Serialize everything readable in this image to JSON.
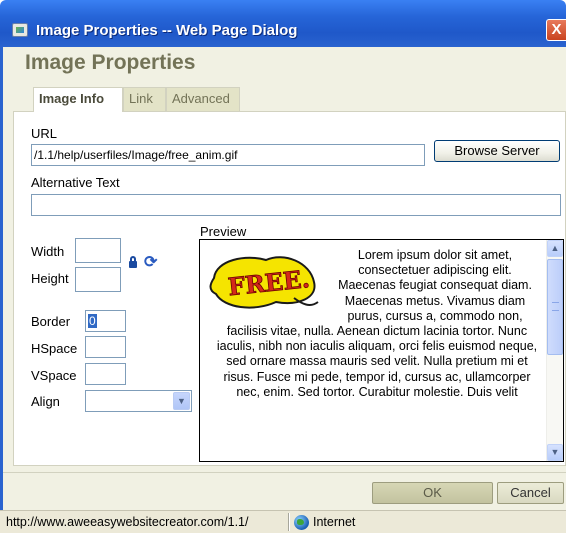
{
  "window": {
    "title": "Image Properties -- Web Page Dialog",
    "close_glyph": "X"
  },
  "dialog": {
    "heading": "Image Properties",
    "tabs": [
      {
        "label": "Image Info",
        "active": true
      },
      {
        "label": "Link",
        "active": false
      },
      {
        "label": "Advanced",
        "active": false
      }
    ]
  },
  "image_info": {
    "url_label": "URL",
    "url_value": "/1.1/help/userfiles/Image/free_anim.gif",
    "browse_label": "Browse Server",
    "alt_label": "Alternative Text",
    "alt_value": "",
    "width_label": "Width",
    "width_value": "",
    "height_label": "Height",
    "height_value": "",
    "border_label": "Border",
    "border_value": "0",
    "hspace_label": "HSpace",
    "hspace_value": "",
    "vspace_label": "VSpace",
    "vspace_value": "",
    "align_label": "Align",
    "align_value": "",
    "preview_label": "Preview",
    "preview_text": "Lorem ipsum dolor sit amet, consectetuer adipiscing elit. Maecenas feugiat consequat diam. Maecenas metus. Vivamus diam purus, cursus a, commodo non, facilisis vitae, nulla. Aenean dictum lacinia tortor. Nunc iaculis, nibh non iaculis aliquam, orci felis euismod neque, sed ornare massa mauris sed velit. Nulla pretium mi et risus. Fusce mi pede, tempor id, cursus ac, ullamcorper nec, enim. Sed tortor. Curabitur molestie. Duis velit",
    "preview_image_text": "FREE."
  },
  "footer": {
    "ok_label": "OK",
    "cancel_label": "Cancel"
  },
  "statusbar": {
    "url": "http://www.aweeasywebsitecreator.com/1.1/",
    "zone": "Internet"
  },
  "colors": {
    "titlebar": "#2665d8",
    "dialog_bg": "#f1f1e3",
    "heading": "#737357",
    "free_yellow": "#f5e400",
    "free_red": "#d42a1a"
  }
}
